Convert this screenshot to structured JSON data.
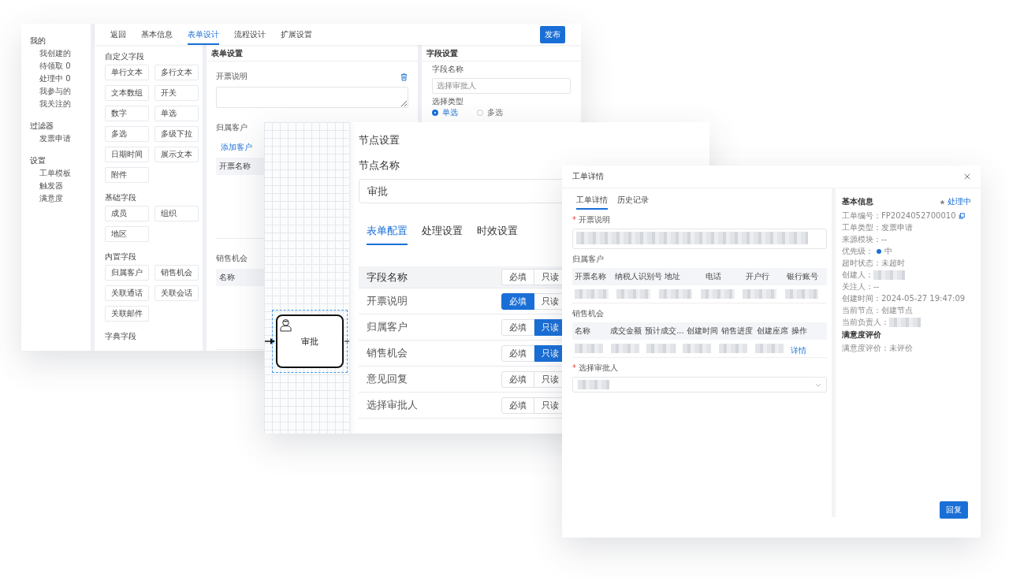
{
  "form_designer": {
    "sidebar": [
      {
        "title": "我的",
        "items": [
          "我创建的",
          "待领取 0",
          "处理中 0",
          "我参与的",
          "我关注的"
        ]
      },
      {
        "title": "过滤器",
        "items": [
          "发票申请"
        ]
      },
      {
        "title": "设置",
        "items": [
          "工单模板",
          "触发器",
          "满意度"
        ]
      }
    ],
    "tabs": [
      {
        "label": "返回",
        "selected": false
      },
      {
        "label": "基本信息",
        "selected": false
      },
      {
        "label": "表单设计",
        "selected": true
      },
      {
        "label": "流程设计",
        "selected": false
      },
      {
        "label": "扩展设置",
        "selected": false
      }
    ],
    "publish_button": "发布",
    "palette": [
      {
        "title": "自定义字段",
        "items": [
          "单行文本",
          "多行文本",
          "文本数组",
          "开关",
          "数字",
          "单选",
          "多选",
          "多级下拉",
          "日期时间",
          "展示文本",
          "附件"
        ]
      },
      {
        "title": "基础字段",
        "items": [
          "成员",
          "组织",
          "地区"
        ]
      },
      {
        "title": "内置字段",
        "items": [
          "归属客户",
          "销售机会",
          "关联通话",
          "关联会话",
          "关联邮件"
        ]
      },
      {
        "title": "字典字段"
      }
    ],
    "form_settings": {
      "title": "表单设置",
      "fields": [
        {
          "kind": "textarea",
          "label": "开票说明"
        },
        {
          "kind": "table",
          "label": "归属客户",
          "add_link": "添加客户",
          "columns": [
            "开票名称"
          ]
        },
        {
          "kind": "table",
          "label": "销售机会",
          "columns": [
            "名称"
          ]
        }
      ]
    },
    "field_settings": {
      "title": "字段设置",
      "name_label": "字段名称",
      "name_placeholder": "选择审批人",
      "type_label": "选择类型",
      "type_options": [
        {
          "label": "单选",
          "selected": true
        },
        {
          "label": "多选",
          "selected": false
        }
      ]
    }
  },
  "node_settings": {
    "node": {
      "label": "审批"
    },
    "title": "节点设置",
    "name_label": "节点名称",
    "name_value": "审批",
    "tabs": [
      {
        "label": "表单配置",
        "selected": true
      },
      {
        "label": "处理设置",
        "selected": false
      },
      {
        "label": "时效设置",
        "selected": false
      }
    ],
    "header": {
      "label": "字段名称",
      "required_label": "必填",
      "readonly_label": "只读",
      "required": false,
      "readonly": false
    },
    "rows": [
      {
        "label": "开票说明",
        "required_label": "必填",
        "readonly_label": "只读",
        "required": true,
        "readonly": false
      },
      {
        "label": "归属客户",
        "required_label": "必填",
        "readonly_label": "只读",
        "required": false,
        "readonly": true
      },
      {
        "label": "销售机会",
        "required_label": "必填",
        "readonly_label": "只读",
        "required": false,
        "readonly": true
      },
      {
        "label": "意见回复",
        "required_label": "必填",
        "readonly_label": "只读",
        "required": false,
        "readonly": false
      },
      {
        "label": "选择审批人",
        "required_label": "必填",
        "readonly_label": "只读",
        "required": false,
        "readonly": false
      }
    ]
  },
  "ticket_detail": {
    "title": "工单详情",
    "tabs": [
      {
        "label": "工单详情",
        "selected": true
      },
      {
        "label": "历史记录",
        "selected": false
      }
    ],
    "fields": [
      {
        "kind": "textarea",
        "label": "开票说明",
        "required_mark": "*"
      },
      {
        "kind": "table",
        "label": "归属客户",
        "columns": [
          "开票名称",
          "纳税人识别号",
          "地址",
          "电话",
          "开户行",
          "银行账号"
        ]
      },
      {
        "kind": "table",
        "label": "销售机会",
        "columns": [
          "名称",
          "成交金额",
          "预计成交...",
          "创建时间",
          "销售进度",
          "创建座席",
          "操作"
        ],
        "action_link": "详情"
      },
      {
        "kind": "select",
        "label": "选择审批人",
        "required_mark": "*"
      }
    ],
    "info": {
      "title": "基本信息",
      "status": "处理中",
      "rows": [
        {
          "kind": "copyable",
          "label": "工单编号：",
          "value": "FP2024052700010"
        },
        {
          "kind": "text",
          "label": "工单类型：",
          "value": "发票申请"
        },
        {
          "kind": "text",
          "label": "来源模块：",
          "value": "--"
        },
        {
          "kind": "priority",
          "label": "优先级：",
          "value": "中",
          "color": "#1a6fd6"
        },
        {
          "kind": "text",
          "label": "超时状态：",
          "value": "未超时"
        },
        {
          "kind": "redacted",
          "label": "创建人："
        },
        {
          "kind": "text",
          "label": "关注人：",
          "value": "--"
        },
        {
          "kind": "text",
          "label": "创建时间：",
          "value": "2024-05-27 19:47:09"
        },
        {
          "kind": "text",
          "label": "当前节点：",
          "value": "创建节点"
        },
        {
          "kind": "redacted",
          "label": "当前负责人："
        }
      ]
    },
    "rating": {
      "title": "满意度评价",
      "label": "满意度评价：",
      "value": "未评价"
    },
    "reply_button": "回复"
  }
}
